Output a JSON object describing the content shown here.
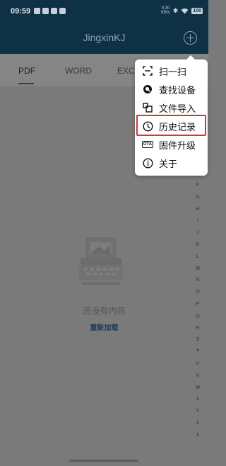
{
  "status_bar": {
    "time": "09:59",
    "speed_value": "0.30",
    "speed_unit": "KB/s",
    "battery": "100"
  },
  "app_bar": {
    "title": "JingxinKJ"
  },
  "tabs": [
    {
      "label": "PDF",
      "active": true
    },
    {
      "label": "WORD",
      "active": false
    },
    {
      "label": "EXCE",
      "active": false
    }
  ],
  "empty_state": {
    "message": "还没有内容",
    "reload_label": "重新加载"
  },
  "menu": {
    "items": [
      {
        "label": "扫一扫",
        "icon": "scan-icon"
      },
      {
        "label": "查找设备",
        "icon": "find-device-icon"
      },
      {
        "label": "文件导入",
        "icon": "file-import-icon"
      },
      {
        "label": "历史记录",
        "icon": "clock-icon",
        "highlighted": true
      },
      {
        "label": "固件升级",
        "icon": "ota-icon",
        "icon_text": "OTA"
      },
      {
        "label": "关于",
        "icon": "info-icon"
      }
    ],
    "highlight_color": "#e0312b"
  },
  "alpha_index": [
    "F",
    "G",
    "H",
    "I",
    "J",
    "K",
    "L",
    "M",
    "N",
    "O",
    "P",
    "Q",
    "R",
    "S",
    "T",
    "U",
    "V",
    "W",
    "X",
    "Y",
    "Z",
    "#"
  ],
  "colors": {
    "app_bar": "#0e3145",
    "accent": "#15465e",
    "overlay_background": "#7a7a7a"
  }
}
